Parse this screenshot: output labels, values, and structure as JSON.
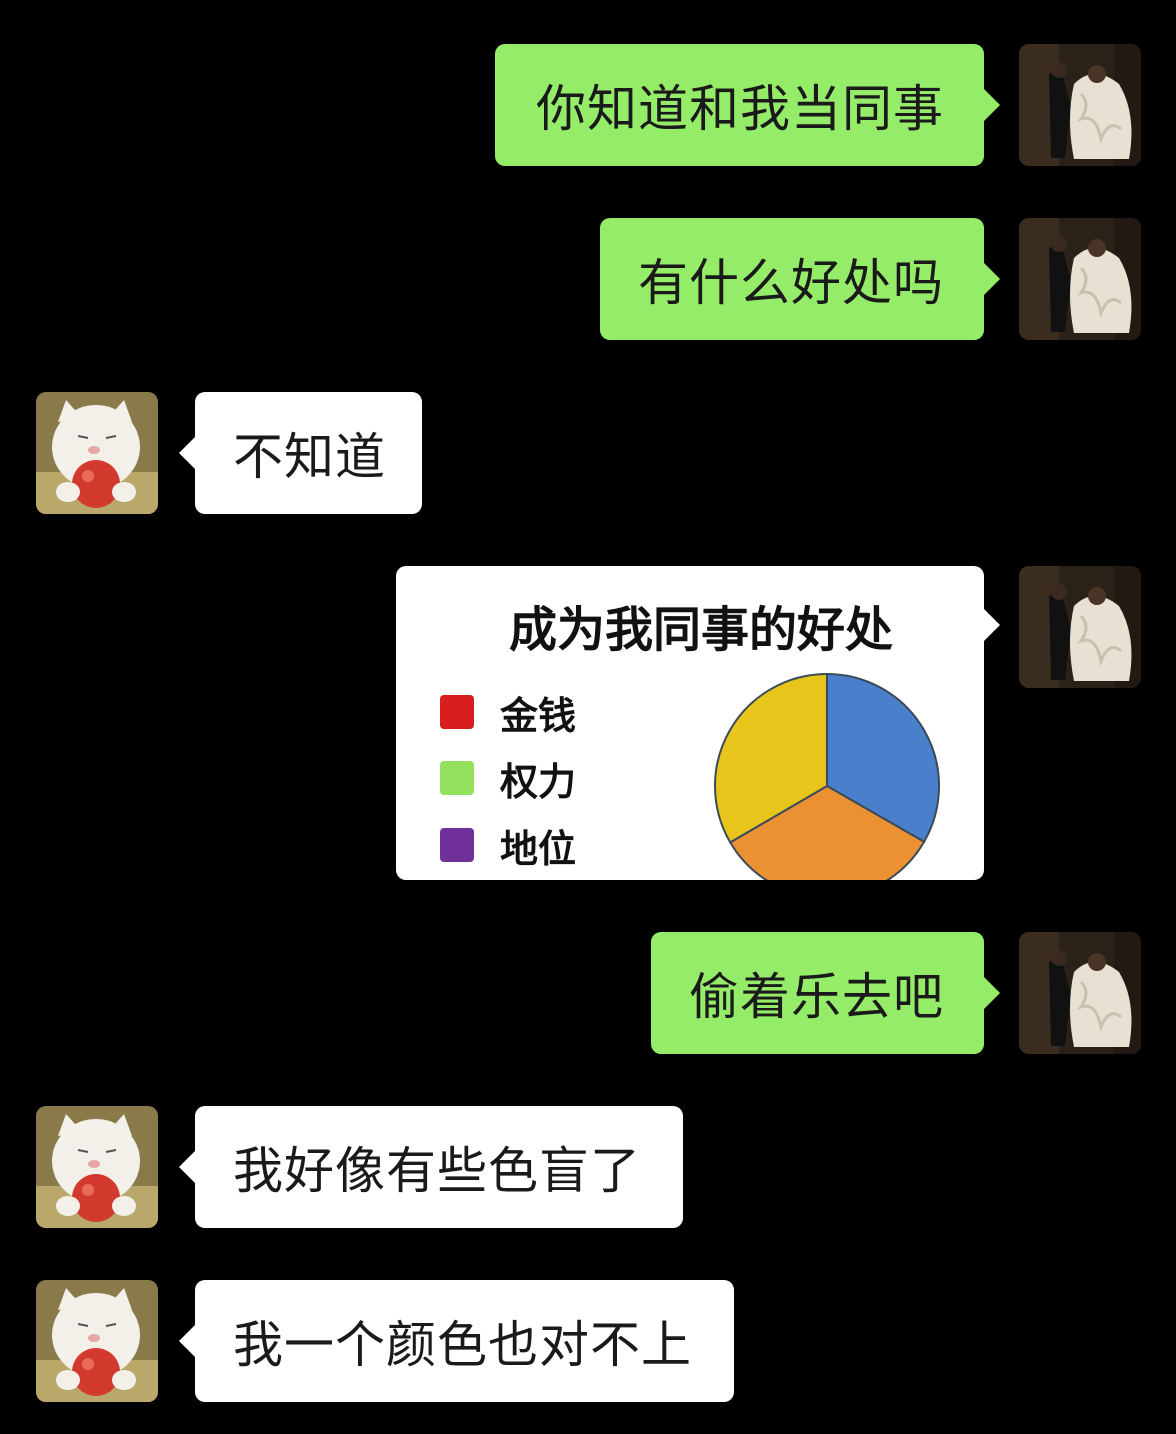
{
  "messages": [
    {
      "side": "mine",
      "text": "你知道和我当同事"
    },
    {
      "side": "mine",
      "text": "有什么好处吗"
    },
    {
      "side": "theirs",
      "text": "不知道"
    },
    {
      "side": "mine",
      "type": "image",
      "description": "chart"
    },
    {
      "side": "mine",
      "text": "偷着乐去吧"
    },
    {
      "side": "theirs",
      "text": "我好像有些色盲了"
    },
    {
      "side": "theirs",
      "text": "我一个颜色也对不上"
    }
  ],
  "avatars": {
    "mine": "photo-avatar-couple",
    "theirs": "cat-holding-apple-avatar"
  },
  "colors": {
    "background": "#000000",
    "mine_bubble": "#95ec69",
    "theirs_bubble": "#ffffff"
  },
  "chart_data": {
    "type": "pie",
    "title": "成为我同事的好处",
    "legend": [
      {
        "label": "金钱",
        "color": "#d81e1e"
      },
      {
        "label": "权力",
        "color": "#92e05e"
      },
      {
        "label": "地位",
        "color": "#70309a"
      }
    ],
    "slices": [
      {
        "value": 33.3,
        "color": "#4a7fcb"
      },
      {
        "value": 33.3,
        "color": "#ec9133"
      },
      {
        "value": 33.4,
        "color": "#e8c51b"
      }
    ]
  }
}
